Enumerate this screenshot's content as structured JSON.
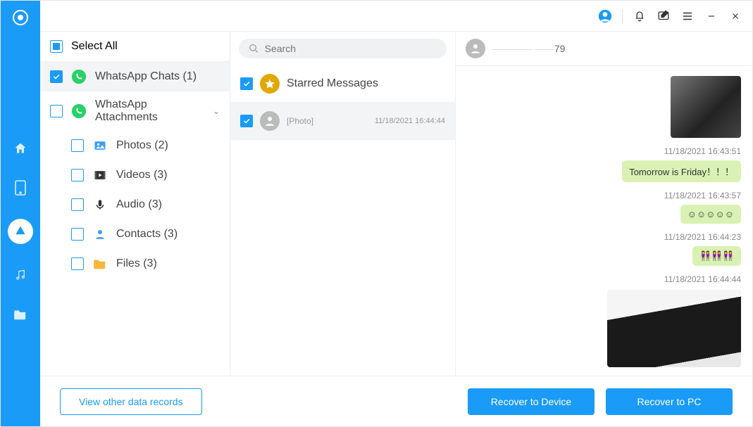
{
  "sidebar": {
    "items": [
      "home",
      "device",
      "cloud",
      "music",
      "folder"
    ],
    "active_index": 2
  },
  "tree": {
    "select_all_label": "Select All",
    "select_all_state": "partial",
    "items": [
      {
        "label": "WhatsApp Chats (1)",
        "icon": "whatsapp",
        "checked": true,
        "selected": true
      },
      {
        "label": "WhatsApp Attachments",
        "icon": "whatsapp",
        "checked": false,
        "expandable": true
      },
      {
        "label": "Photos (2)",
        "icon": "photos",
        "checked": false,
        "sub": true
      },
      {
        "label": "Videos (3)",
        "icon": "videos",
        "checked": false,
        "sub": true
      },
      {
        "label": "Audio (3)",
        "icon": "audio",
        "checked": false,
        "sub": true
      },
      {
        "label": "Contacts (3)",
        "icon": "contacts",
        "checked": false,
        "sub": true
      },
      {
        "label": "Files (3)",
        "icon": "files",
        "checked": false,
        "sub": true
      }
    ]
  },
  "search": {
    "placeholder": "Search"
  },
  "chats": [
    {
      "label": "Starred Messages",
      "icon": "star",
      "checked": true
    },
    {
      "name": "",
      "preview": "[Photo]",
      "time": "11/18/2021 16:44:44",
      "checked": true,
      "selected": true
    }
  ],
  "conversation": {
    "contact_suffix": "79",
    "messages": [
      {
        "type": "photo",
        "time": ""
      },
      {
        "type": "text",
        "time": "11/18/2021 16:43:51",
        "text": "Tomorrow is Friday！！！"
      },
      {
        "type": "text",
        "time": "11/18/2021 16:43:57",
        "text": "☺☺☺☺☺"
      },
      {
        "type": "text",
        "time": "11/18/2021 16:44:23",
        "text": "👭👭👭"
      },
      {
        "type": "photo-large",
        "time": "11/18/2021 16:44:44"
      }
    ]
  },
  "footer": {
    "view_other": "View other data records",
    "recover_device": "Recover to Device",
    "recover_pc": "Recover to PC"
  }
}
